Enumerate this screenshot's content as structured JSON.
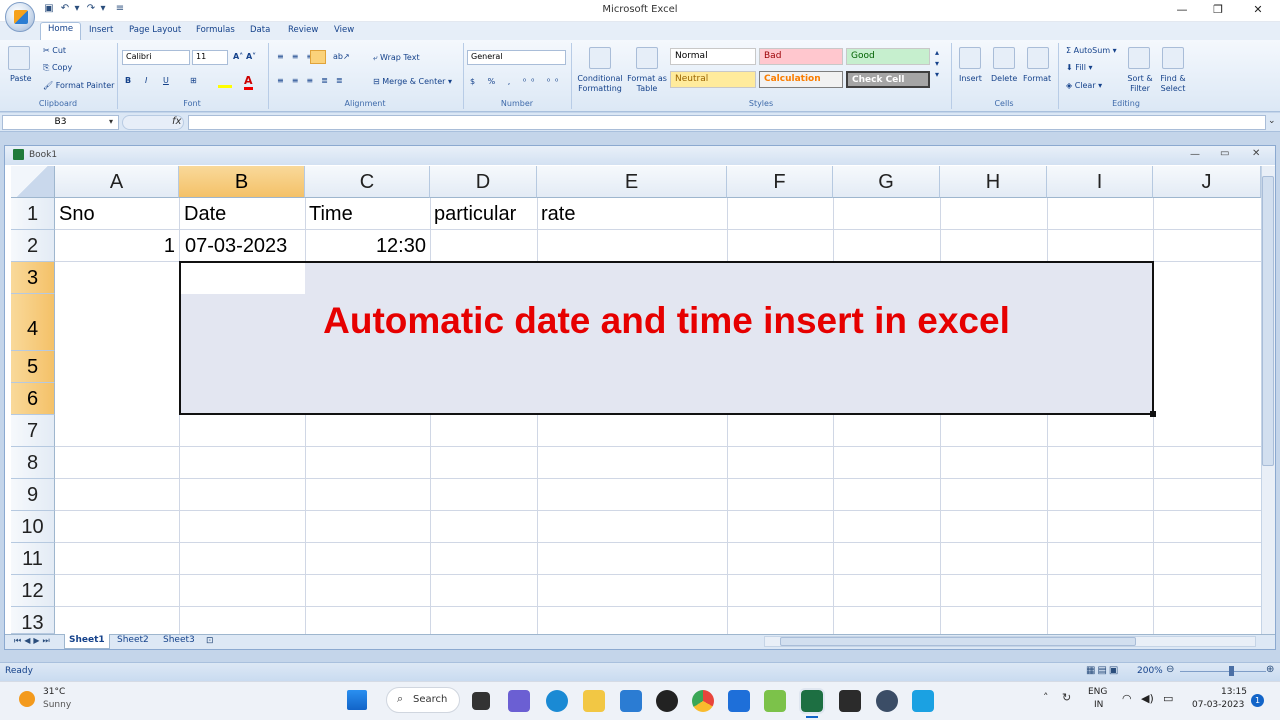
{
  "app": {
    "title": "Microsoft Excel"
  },
  "tabs": [
    "Home",
    "Insert",
    "Page Layout",
    "Formulas",
    "Data",
    "Review",
    "View"
  ],
  "ribbon": {
    "clipboard": {
      "paste": "Paste",
      "cut": "Cut",
      "copy": "Copy",
      "format_painter": "Format Painter",
      "label": "Clipboard"
    },
    "font": {
      "name": "Calibri",
      "size": "11",
      "label": "Font"
    },
    "alignment": {
      "wrap": "Wrap Text",
      "merge": "Merge & Center",
      "label": "Alignment"
    },
    "number": {
      "format": "General",
      "label": "Number"
    },
    "styles": {
      "conditional": "Conditional Formatting",
      "format_table": "Format as Table",
      "normal": "Normal",
      "bad": "Bad",
      "good": "Good",
      "neutral": "Neutral",
      "calculation": "Calculation",
      "check_cell": "Check Cell",
      "label": "Styles"
    },
    "cells": {
      "insert": "Insert",
      "delete": "Delete",
      "format": "Format",
      "label": "Cells"
    },
    "editing": {
      "autosum": "AutoSum",
      "fill": "Fill",
      "clear": "Clear",
      "sort": "Sort & Filter",
      "find": "Find & Select",
      "label": "Editing"
    }
  },
  "formula_bar": {
    "name_box": "B3",
    "fx": "fx",
    "content": ""
  },
  "workbook": {
    "title": "Book1"
  },
  "columns": [
    "A",
    "B",
    "C",
    "D",
    "E",
    "F",
    "G",
    "H",
    "I",
    "J"
  ],
  "rows": [
    "1",
    "2",
    "3",
    "4",
    "5",
    "6",
    "7",
    "8",
    "9",
    "10",
    "11",
    "12",
    "13"
  ],
  "cells": {
    "A1": "Sno",
    "B1": "Date",
    "C1": "Time",
    "D1": "particular",
    "E1": "rate",
    "A2": "1",
    "B2": "07-03-2023",
    "C2": "12:30"
  },
  "banner": "Automatic date and time insert in excel",
  "sheets": [
    "Sheet1",
    "Sheet2",
    "Sheet3"
  ],
  "status": {
    "ready": "Ready",
    "zoom": "200%"
  },
  "taskbar": {
    "weather_temp": "31°C",
    "weather_desc": "Sunny",
    "search": "Search",
    "lang1": "ENG",
    "lang2": "IN",
    "time": "13:15",
    "date": "07-03-2023",
    "notif": "1"
  }
}
